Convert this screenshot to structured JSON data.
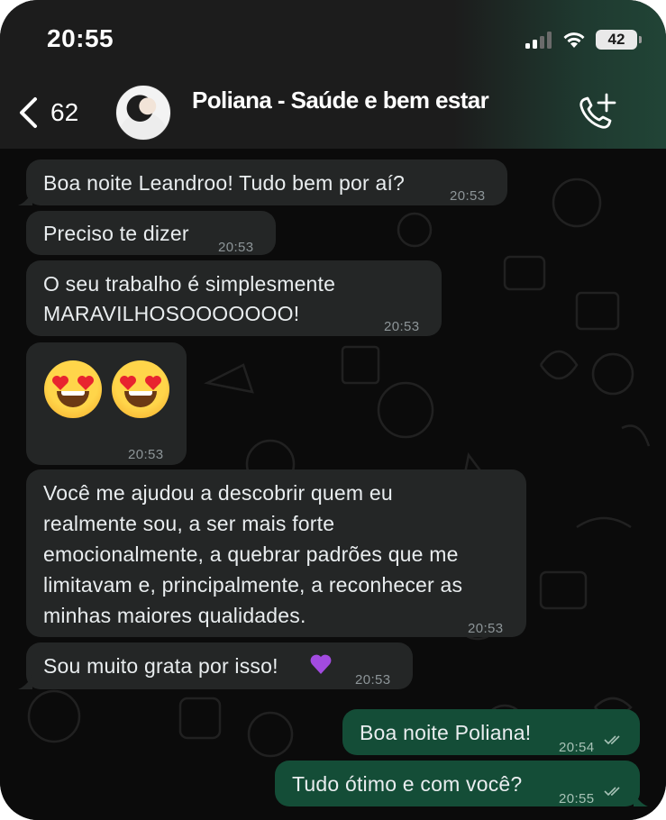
{
  "status_bar": {
    "time": "20:55",
    "battery": "42"
  },
  "header": {
    "back_count": "62",
    "contact_name": "Poliana - Saúde e bem estar"
  },
  "messages": [
    {
      "direction": "incoming",
      "text": "Boa noite Leandroo! Tudo bem por aí?",
      "time": "20:53"
    },
    {
      "direction": "incoming",
      "text": "Preciso te dizer",
      "time": "20:53"
    },
    {
      "direction": "incoming",
      "lines": [
        "O seu trabalho é simplesmente",
        "MARAVILHOSOOOOOOO!"
      ],
      "time": "20:53"
    },
    {
      "direction": "incoming",
      "emoji": [
        "smiling-face-with-heart-eyes",
        "smiling-face-with-heart-eyes"
      ],
      "time": "20:53"
    },
    {
      "direction": "incoming",
      "lines": [
        "Você me ajudou a descobrir quem eu",
        "realmente sou, a ser mais forte",
        "emocionalmente, a quebrar padrões que me",
        "limitavam e, principalmente, a reconhecer as",
        "minhas maiores qualidades."
      ],
      "time": "20:53"
    },
    {
      "direction": "incoming",
      "text": "Sou muito grata por isso!",
      "emoji": "purple-heart",
      "time": "20:53"
    },
    {
      "direction": "outgoing",
      "text": "Boa noite Poliana!",
      "time": "20:54",
      "status": "read"
    },
    {
      "direction": "outgoing",
      "text": "Tudo ótimo e com você?",
      "time": "20:55",
      "status": "read"
    }
  ],
  "colors": {
    "incoming_bubble": "#242626",
    "outgoing_bubble": "#144d37",
    "chat_background": "#0b0b0b",
    "header_background": "#1c1c1c",
    "accent_green": "#214436"
  }
}
